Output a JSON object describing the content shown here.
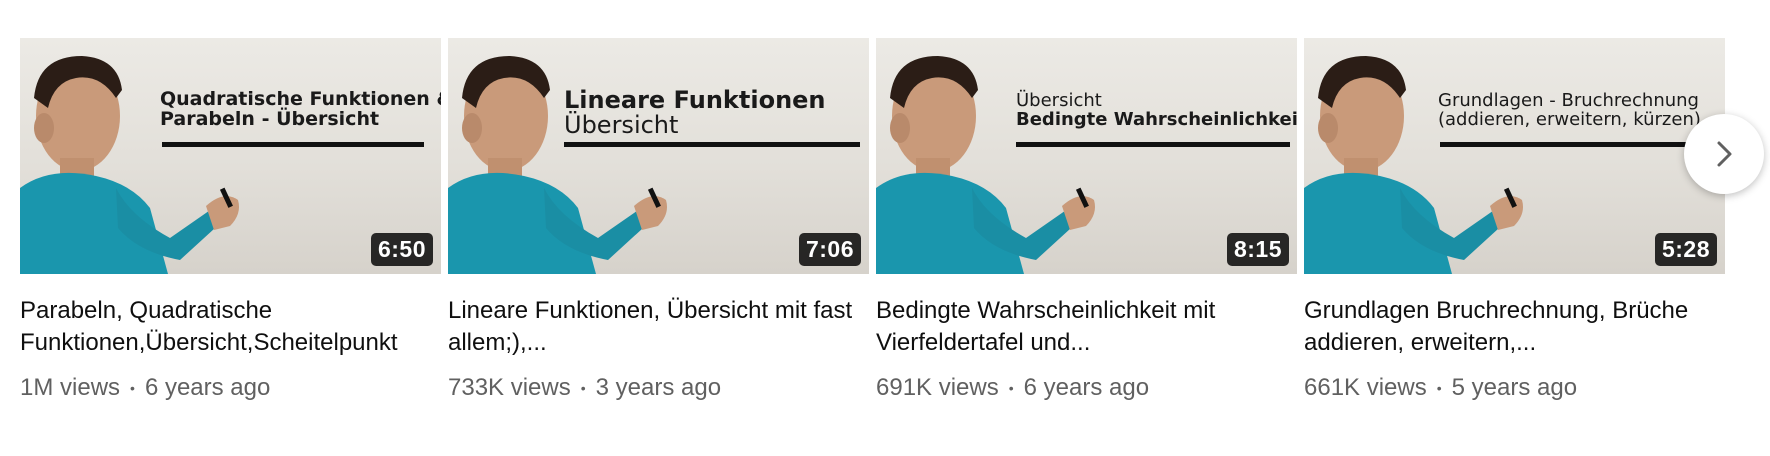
{
  "videos": [
    {
      "board_line1": "Quadratische Funktionen &",
      "board_line1_bold": true,
      "board_line2": "Parabeln - Übersicht",
      "duration": "6:50",
      "title": "Parabeln, Quadratische Funktionen,Übersicht,Scheitelpunkt",
      "views": "1M views",
      "age": "6 years ago"
    },
    {
      "board_line1": "Lineare Funktionen",
      "board_line2": "Übersicht",
      "duration": "7:06",
      "title": "Lineare Funktionen, Übersicht mit fast allem;),...",
      "views": "733K views",
      "age": "3 years ago"
    },
    {
      "board_line1": "Übersicht",
      "board_line2": "Bedingte Wahrscheinlichkeit",
      "duration": "8:15",
      "title": "Bedingte Wahrscheinlichkeit mit Vierfeldertafel und...",
      "views": "691K views",
      "age": "6 years ago"
    },
    {
      "board_line1": "Grundlagen - Bruchrechnung",
      "board_line2": "(addieren, erweitern, kürzen)",
      "duration": "5:28",
      "title": "Grundlagen Bruchrechnung, Brüche addieren, erweitern,...",
      "views": "661K views",
      "age": "5 years ago"
    }
  ],
  "separator": "•",
  "next_button_icon": "chevron-right-icon",
  "colors": {
    "shirt": "#1a96ad",
    "duration_bg": "#000000",
    "meta_text": "#606060"
  }
}
